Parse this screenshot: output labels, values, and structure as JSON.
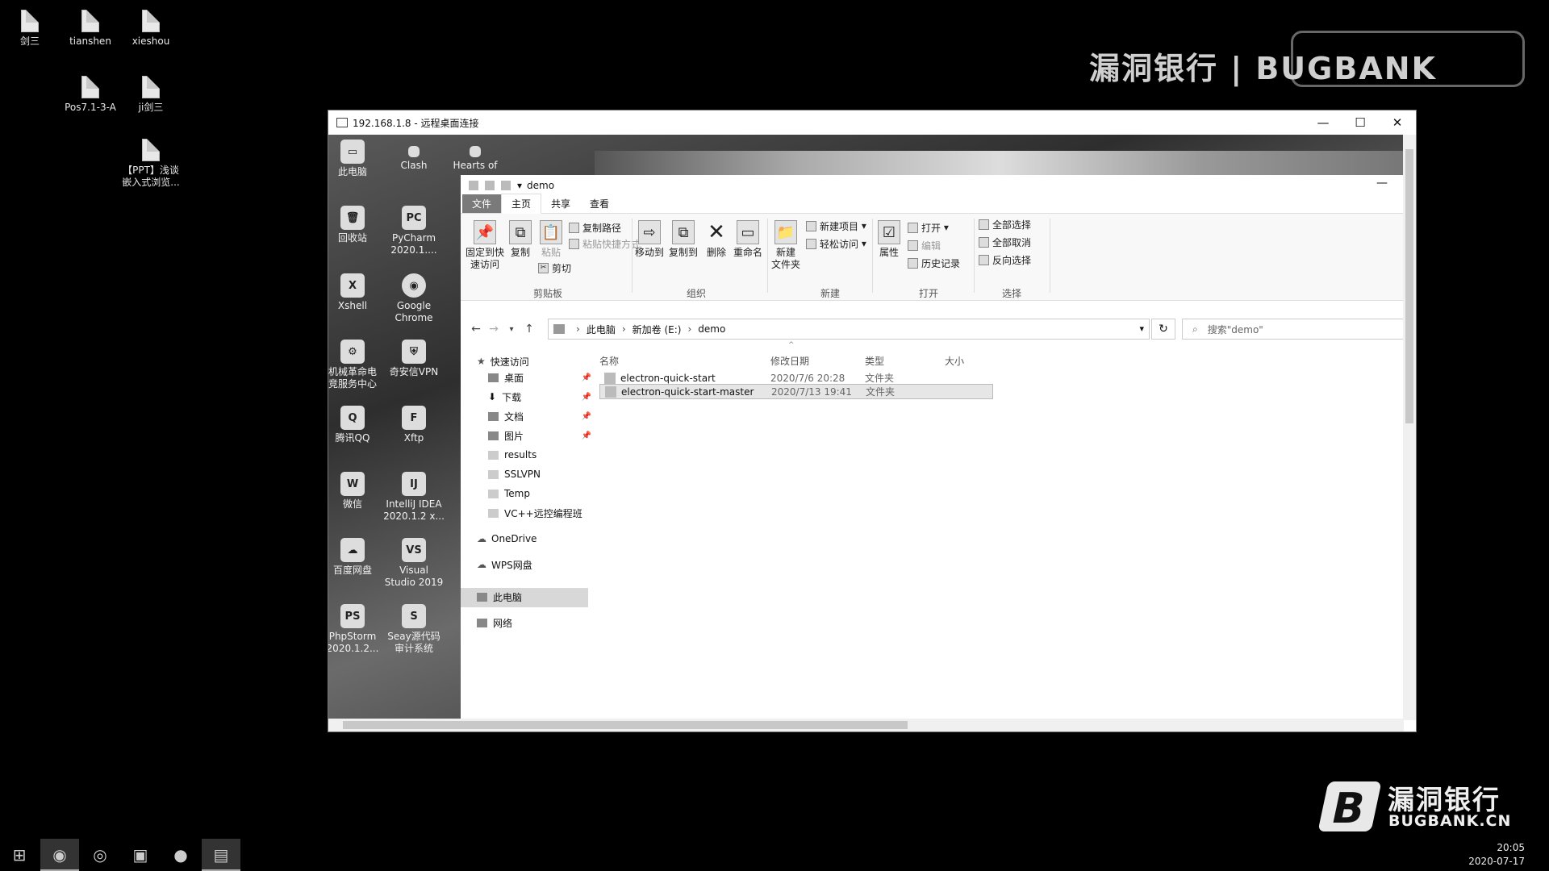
{
  "host_desktop": {
    "icons": [
      {
        "label": "剑三"
      },
      {
        "label": "tianshen"
      },
      {
        "label": "xieshou"
      },
      {
        "label": "Pos7.1-3-A"
      },
      {
        "label": "ji剑三"
      },
      {
        "label": "【PPT】浅谈\n嵌入式浏览..."
      }
    ]
  },
  "watermark": {
    "top_text": "漏洞银行 | BUGBANK",
    "brand_cn": "漏洞银行",
    "brand_en": "BUGBANK.CN"
  },
  "taskbar": {
    "time": "20:05",
    "date": "2020-07-17"
  },
  "rdp": {
    "title": "192.168.1.8 - 远程桌面连接",
    "minimize": "—",
    "maximize": "☐",
    "close": "✕"
  },
  "remote_desktop": {
    "icons": [
      {
        "label": "此电脑"
      },
      {
        "label": "Clash"
      },
      {
        "label": "Hearts of"
      },
      {
        "label": "回收站"
      },
      {
        "label": "PyCharm\n2020.1...."
      },
      {
        "label": "Xshell"
      },
      {
        "label": "Google\nChrome"
      },
      {
        "label": "机械革命电\n竞服务中心"
      },
      {
        "label": "奇安信VPN"
      },
      {
        "label": "腾讯QQ"
      },
      {
        "label": "Xftp"
      },
      {
        "label": "微信"
      },
      {
        "label": "IntelliJ IDEA\n2020.1.2 x..."
      },
      {
        "label": "百度网盘"
      },
      {
        "label": "Visual\nStudio 2019"
      },
      {
        "label": "PhpStorm\n2020.1.2..."
      },
      {
        "label": "Seay源代码\n审计系统"
      }
    ]
  },
  "explorer": {
    "title": "demo",
    "tabs": {
      "file": "文件",
      "home": "主页",
      "share": "共享",
      "view": "查看"
    },
    "ribbon": {
      "pin": "固定到快\n速访问",
      "copy": "复制",
      "paste": "粘贴",
      "copy_path": "复制路径",
      "paste_shortcut": "粘贴快捷方式",
      "cut": "剪切",
      "clipboard": "剪贴板",
      "move_to": "移动到",
      "copy_to": "复制到",
      "delete": "删除",
      "rename": "重命名",
      "organize": "组织",
      "new_folder": "新建\n文件夹",
      "new_item": "新建项目",
      "easy_access": "轻松访问",
      "new_group": "新建",
      "properties": "属性",
      "open": "打开",
      "edit": "编辑",
      "history": "历史记录",
      "open_group": "打开",
      "select_all": "全部选择",
      "select_none": "全部取消",
      "invert": "反向选择",
      "select_group": "选择"
    },
    "address": {
      "crumbs": [
        "此电脑",
        "新加卷 (E:)",
        "demo"
      ],
      "search_placeholder": "搜索\"demo\""
    },
    "nav_pane": {
      "quick_access": "快速访问",
      "items": [
        {
          "label": "桌面",
          "pinned": true
        },
        {
          "label": "下载",
          "pinned": true
        },
        {
          "label": "文档",
          "pinned": true
        },
        {
          "label": "图片",
          "pinned": true
        },
        {
          "label": "results",
          "pinned": false
        },
        {
          "label": "SSLVPN",
          "pinned": false
        },
        {
          "label": "Temp",
          "pinned": false
        },
        {
          "label": "VC++远控编程班",
          "pinned": false
        }
      ],
      "onedrive": "OneDrive",
      "wps": "WPS网盘",
      "this_pc": "此电脑",
      "network": "网络"
    },
    "columns": {
      "name": "名称",
      "date": "修改日期",
      "type": "类型",
      "size": "大小"
    },
    "files": [
      {
        "name": "electron-quick-start",
        "date": "2020/7/6 20:28",
        "type": "文件夹"
      },
      {
        "name": "electron-quick-start-master",
        "date": "2020/7/13 19:41",
        "type": "文件夹"
      }
    ]
  }
}
